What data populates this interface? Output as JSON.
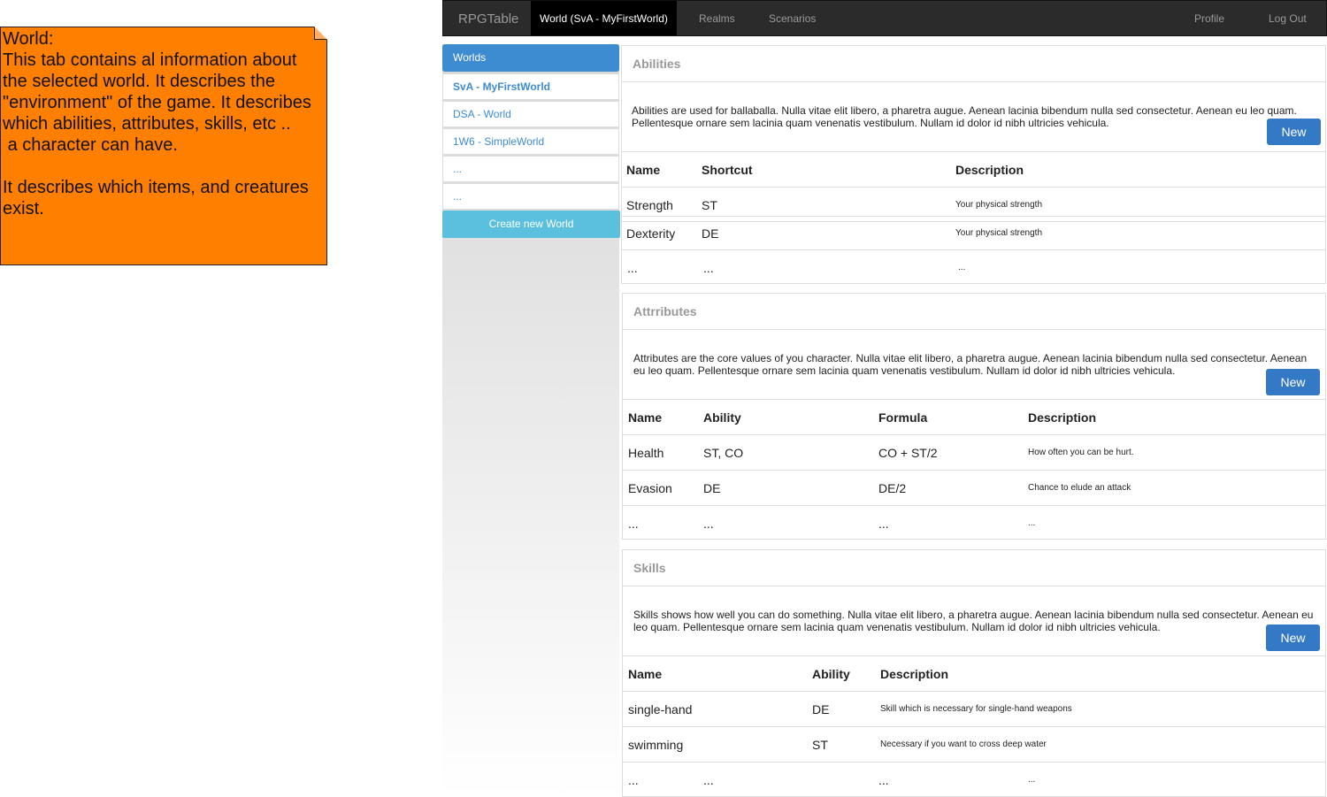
{
  "note": {
    "text": "World:\nThis tab contains al information about the selected world. It describes the \"environment\" of the game. It describes which abilities, attributes, skills, etc ..\n a character can have.\n\nIt describes which items, and creatures exist."
  },
  "navbar": {
    "brand": "RPGTable",
    "tabs": [
      "World (SvA - MyFirstWorld)",
      "Realms",
      "Scenarios"
    ],
    "profile": "Profile",
    "logout": "Log Out"
  },
  "sidebar": {
    "header": "Worlds",
    "items": [
      "SvA - MyFirstWorld",
      "DSA - World",
      "1W6 - SimpleWorld",
      "...",
      "..."
    ],
    "create_button": "Create new World"
  },
  "abilities": {
    "title": "Abilities",
    "description": "Abilities are used for ballaballa. Nulla vitae elit libero, a pharetra augue. Aenean lacinia bibendum nulla sed consectetur. Aenean eu leo quam. Pellentesque ornare sem lacinia quam venenatis vestibulum. Nullam id dolor id nibh ultricies vehicula.",
    "new_button": "New",
    "columns": [
      "Name",
      "Shortcut",
      "Description"
    ],
    "rows": [
      [
        "Strength",
        "ST",
        "Your physical strength"
      ],
      [
        "Dexterity",
        "DE",
        "Your physical strength"
      ],
      [
        "...",
        "...",
        "..."
      ]
    ]
  },
  "attributes": {
    "title": "Attrributes",
    "description": "Attributes are the core values of you character. Nulla vitae elit libero, a pharetra augue. Aenean lacinia bibendum nulla sed consectetur. Aenean eu leo quam. Pellentesque ornare sem lacinia quam venenatis vestibulum. Nullam id dolor id nibh ultricies vehicula.",
    "new_button": "New",
    "columns": [
      "Name",
      "Ability",
      "Formula",
      "Description"
    ],
    "rows": [
      [
        "Health",
        "ST, CO",
        "CO + ST/2",
        "How often you can be hurt."
      ],
      [
        "Evasion",
        "DE",
        "DE/2",
        "Chance to elude an attack"
      ],
      [
        "...",
        "...",
        "...",
        "..."
      ]
    ]
  },
  "skills": {
    "title": "Skills",
    "description": "Skills shows how well you can do something. Nulla vitae elit libero, a pharetra augue. Aenean lacinia bibendum nulla sed consectetur. Aenean eu leo quam. Pellentesque ornare sem lacinia quam venenatis vestibulum. Nullam id dolor id nibh ultricies vehicula.",
    "new_button": "New",
    "columns": [
      "Name",
      "Ability",
      "Description"
    ],
    "rows": [
      [
        "single-hand",
        "DE",
        "Skill which is necessary for single-hand weapons"
      ],
      [
        "swimming",
        "ST",
        "Necessary if you want to cross deep water"
      ],
      [
        "...",
        "...",
        "...",
        "..."
      ]
    ]
  }
}
